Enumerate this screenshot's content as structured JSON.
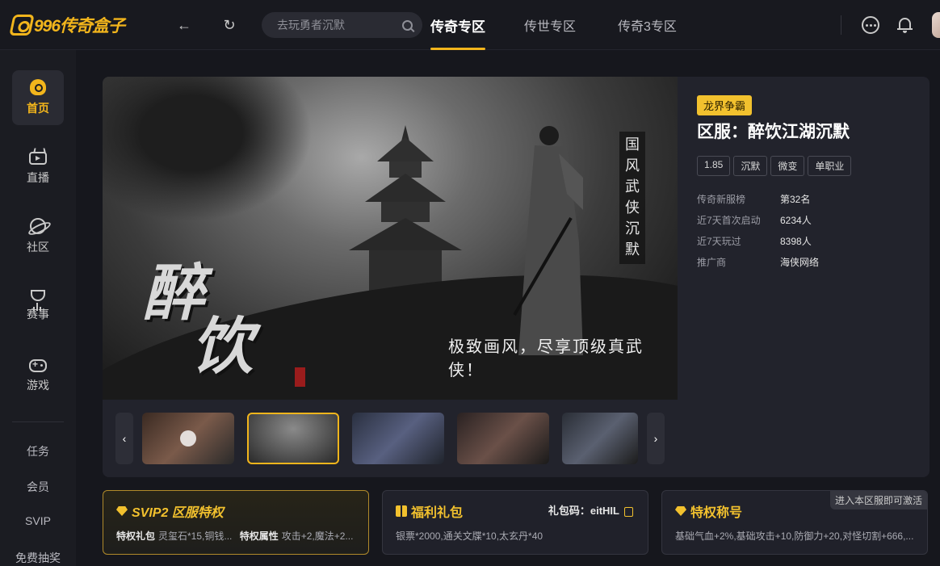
{
  "app": {
    "logo_text": "996传奇盒子"
  },
  "search": {
    "placeholder": "去玩勇者沉默"
  },
  "tabs": [
    {
      "label": "传奇专区",
      "active": true
    },
    {
      "label": "传世专区",
      "active": false
    },
    {
      "label": "传奇3专区",
      "active": false
    }
  ],
  "sidebar": {
    "items": [
      {
        "label": "首页",
        "icon": "home-icon",
        "active": true
      },
      {
        "label": "直播",
        "icon": "tv-icon"
      },
      {
        "label": "社区",
        "icon": "planet-icon"
      },
      {
        "label": "赛事",
        "icon": "trophy-icon"
      },
      {
        "label": "游戏",
        "icon": "gamepad-icon"
      }
    ],
    "links": [
      "任务",
      "会员",
      "SVIP",
      "免费抽奖"
    ]
  },
  "banner": {
    "calligraphy": [
      "醉",
      "饮"
    ],
    "vertical_text": "国风武侠沉默",
    "slogan": "极致画风，尽享顶级真武侠！"
  },
  "server": {
    "badge": "龙界争霸",
    "title": "区服：醉饮江湖沉默",
    "tags": [
      "1.85",
      "沉默",
      "微变",
      "单职业"
    ],
    "stats": [
      {
        "key": "传奇新服榜",
        "value": "第32名"
      },
      {
        "key": "近7天首次启动",
        "value": "6234人"
      },
      {
        "key": "近7天玩过",
        "value": "8398人"
      },
      {
        "key": "推广商",
        "value": "海侠网络"
      }
    ]
  },
  "cards": {
    "svip": {
      "title": "SVIP2 区服特权",
      "gift_label": "特权礼包",
      "gift_text": "灵玺石*15,铜钱...",
      "attr_label": "特权属性",
      "attr_text": "攻击+2,魔法+2..."
    },
    "gift": {
      "title": "福利礼包",
      "code_label": "礼包码：eitHIL",
      "text": "银票*2000,通关文牒*10,太玄丹*40"
    },
    "title_card": {
      "title": "特权称号",
      "activate": "进入本区服即可激活",
      "text": "基础气血+2%,基础攻击+10,防御力+20,对怪切割+666,..."
    }
  },
  "colors": {
    "accent": "#f2b51c",
    "background": "#16171d",
    "panel": "#22232c"
  }
}
